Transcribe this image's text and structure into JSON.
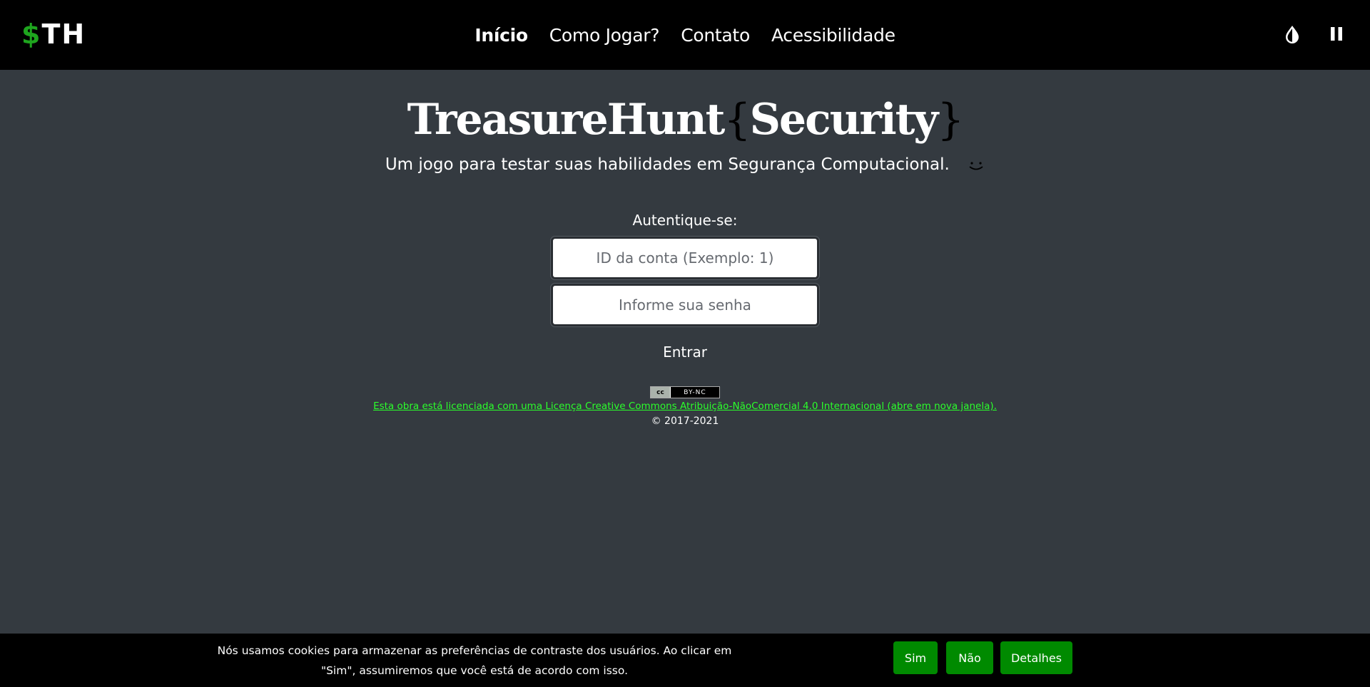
{
  "navbar": {
    "brand_symbol": "$",
    "brand_letters": "TH",
    "links": [
      {
        "label": "Início",
        "active": true
      },
      {
        "label": "Como Jogar?",
        "active": false
      },
      {
        "label": "Contato",
        "active": false
      },
      {
        "label": "Acessibilidade",
        "active": false
      }
    ],
    "tools": [
      {
        "icon": "contrast-icon"
      },
      {
        "icon": "pause-icon"
      }
    ]
  },
  "hero": {
    "title_main": "TreasureHunt",
    "brace_open": "{",
    "title_accent": "Security",
    "brace_close": "}",
    "subtitle": "Um jogo para testar suas habilidades em Segurança Computacional."
  },
  "login": {
    "label": "Autentique-se:",
    "account_placeholder": "ID da conta (Exemplo: 1)",
    "password_placeholder": "Informe sua senha",
    "submit_label": "Entrar"
  },
  "footer": {
    "badge_left": "cc",
    "badge_right": "BY-NC",
    "license_text": "Esta obra está licenciada com uma Licença Creative Commons Atribuição-NãoComercial 4.0 Internacional (abre em nova janela).",
    "copyright": "© 2017-2021"
  },
  "cookies": {
    "message": "Nós usamos cookies para armazenar as preferências de contraste dos usuários. Ao clicar em \"Sim\", assumiremos que você está de acordo com isso.",
    "yes_label": "Sim",
    "no_label": "Não",
    "details_label": "Detalhes"
  },
  "colors": {
    "page_bg": "#343a40",
    "navbar_bg": "#000000",
    "brand_accent": "#1ea51e",
    "link_green": "#2bff2b",
    "button_green": "#008a00"
  }
}
